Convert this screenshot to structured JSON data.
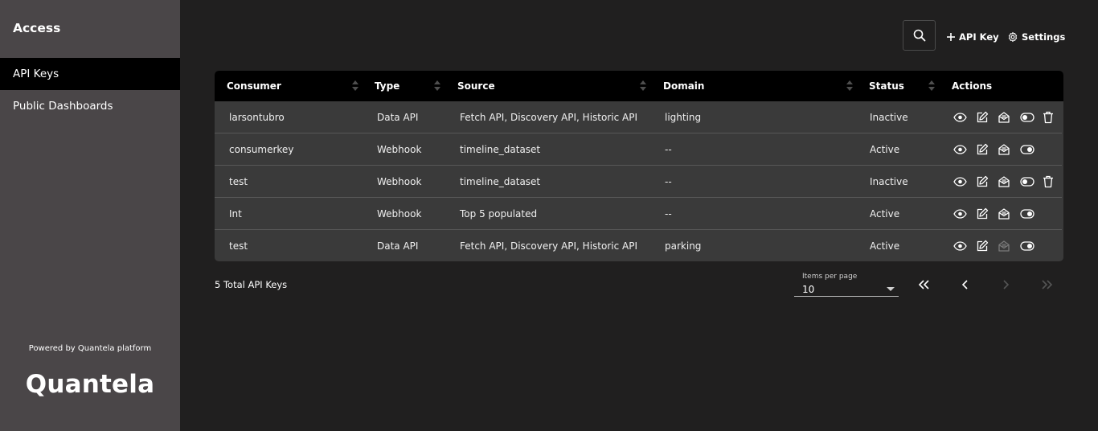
{
  "sidebar": {
    "title": "Access",
    "items": [
      {
        "label": "API Keys",
        "active": true
      },
      {
        "label": "Public Dashboards",
        "active": false
      }
    ],
    "powered_by": "Powered by Quantela platform",
    "logo": "Quantela"
  },
  "toolbar": {
    "search_icon": "search-icon",
    "add_label": "API Key",
    "settings_label": "Settings"
  },
  "table": {
    "columns": [
      "Consumer",
      "Type",
      "Source",
      "Domain",
      "Status",
      "Actions"
    ],
    "rows": [
      {
        "consumer": "larsontubro",
        "type": "Data API",
        "source": "Fetch API, Discovery API, Historic API",
        "domain": "lighting",
        "status": "Inactive",
        "actions": [
          "view",
          "edit",
          "mail",
          "toggle-off",
          "delete"
        ]
      },
      {
        "consumer": "consumerkey",
        "type": "Webhook",
        "source": "timeline_dataset",
        "domain": "--",
        "status": "Active",
        "actions": [
          "view",
          "edit",
          "mail",
          "toggle-on"
        ]
      },
      {
        "consumer": "test",
        "type": "Webhook",
        "source": "timeline_dataset",
        "domain": "--",
        "status": "Inactive",
        "actions": [
          "view",
          "edit",
          "mail",
          "toggle-off",
          "delete"
        ]
      },
      {
        "consumer": "Int",
        "type": "Webhook",
        "source": "Top 5 populated",
        "domain": "--",
        "status": "Active",
        "actions": [
          "view",
          "edit",
          "mail",
          "toggle-on"
        ]
      },
      {
        "consumer": "test",
        "type": "Data API",
        "source": "Fetch API, Discovery API, Historic API",
        "domain": "parking",
        "status": "Active",
        "actions": [
          "view",
          "edit",
          "mail-disabled",
          "toggle-on"
        ]
      }
    ]
  },
  "footer": {
    "total": "5 Total API Keys",
    "items_per_page_label": "Items per page",
    "items_per_page_value": "10"
  },
  "colors": {
    "sidebar_bg": "#4a4648",
    "page_bg": "#201f1f",
    "table_bg": "#3a3a3a",
    "header_bg": "#000000",
    "active_nav": "#000000"
  }
}
